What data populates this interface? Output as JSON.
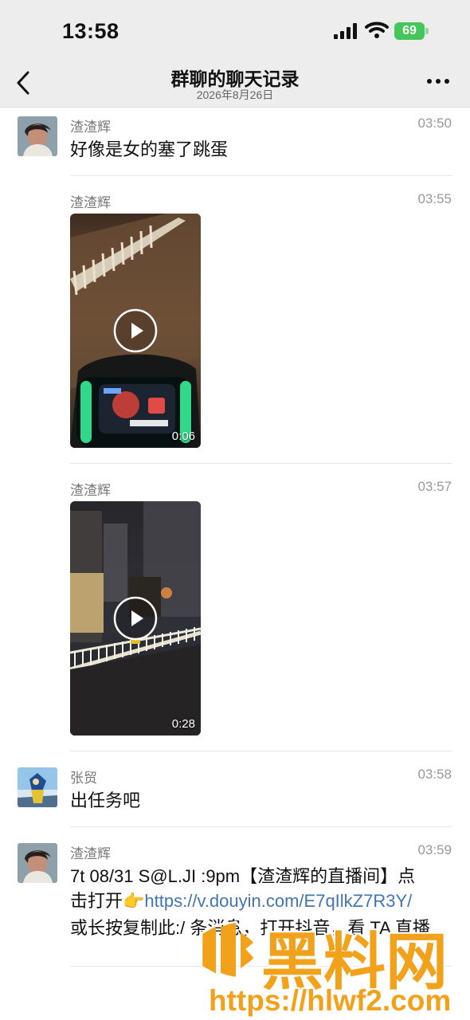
{
  "status_bar": {
    "time": "13:58",
    "battery": "69"
  },
  "nav": {
    "title": "群聊的聊天记录",
    "subtitle": "2026年8月26日"
  },
  "messages": [
    {
      "sender": "渣渣辉",
      "time": "03:50",
      "text": "好像是女的塞了跳蛋"
    },
    {
      "sender": "渣渣辉",
      "time": "03:55",
      "duration": "0:06"
    },
    {
      "sender": "渣渣辉",
      "time": "03:57",
      "duration": "0:28"
    },
    {
      "sender": "张贸",
      "time": "03:58",
      "text": "出任务吧"
    },
    {
      "sender": "渣渣辉",
      "time": "03:59",
      "line1": "7t 08/31 S@L.JI :9pm【渣渣辉的直播间】点",
      "line2_prefix": "击打开👉",
      "link": "https://v.douyin.com/E7qIlkZ7R3Y/",
      "line3": "或长按复制此:/ 条消息，打开抖音，看 TA 直播"
    }
  ],
  "watermark": {
    "title": "黑料网",
    "url": "https://hlwf2.com"
  },
  "colors": {
    "header_bg": "#ededed",
    "link": "#4273b5",
    "watermark": "#f2a11b",
    "battery": "#44c65a"
  }
}
